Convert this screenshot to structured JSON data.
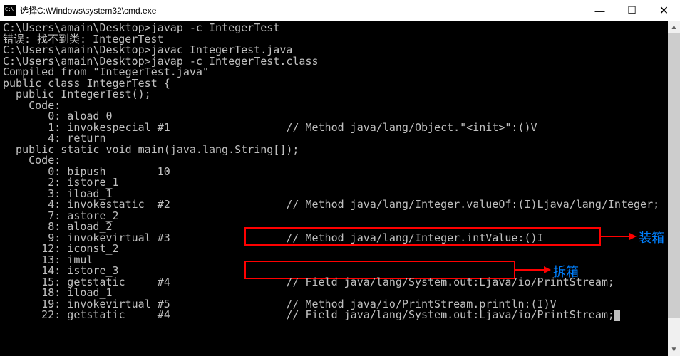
{
  "window": {
    "title": "选择C:\\Windows\\system32\\cmd.exe",
    "buttons": {
      "min": "—",
      "max": "☐",
      "close": "✕"
    }
  },
  "terminal": {
    "line01": "C:\\Users\\amain\\Desktop>javap -c IntegerTest",
    "line02": "错误: 找不到类: IntegerTest",
    "line03": "",
    "line04": "C:\\Users\\amain\\Desktop>javac IntegerTest.java",
    "line05": "",
    "line06": "C:\\Users\\amain\\Desktop>javap -c IntegerTest.class",
    "line07": "Compiled from \"IntegerTest.java\"",
    "line08": "public class IntegerTest {",
    "line09": "  public IntegerTest();",
    "line10": "    Code:",
    "line11": "       0: aload_0",
    "line12": "       1: invokespecial #1                  // Method java/lang/Object.\"<init>\":()V",
    "line13": "       4: return",
    "line14": "",
    "line15": "  public static void main(java.lang.String[]);",
    "line16": "    Code:",
    "line17": "       0: bipush        10",
    "line18": "       2: istore_1",
    "line19": "       3: iload_1",
    "line20": "       4: invokestatic  #2                  // Method java/lang/Integer.valueOf:(I)Ljava/lang/Integer;",
    "line21": "       7: astore_2",
    "line22": "       8: aload_2",
    "line23": "       9: invokevirtual #3                  // Method java/lang/Integer.intValue:()I",
    "line24": "      12: iconst_2",
    "line25": "      13: imul",
    "line26": "      14: istore_3",
    "line27": "      15: getstatic     #4                  // Field java/lang/System.out:Ljava/io/PrintStream;",
    "line28": "      18: iload_1",
    "line29": "      19: invokevirtual #5                  // Method java/io/PrintStream.println:(I)V",
    "line30": "      22: getstatic     #4                  // Field java/lang/System.out:Ljava/io/PrintStream;"
  },
  "annotations": {
    "boxing": "装箱",
    "unboxing": "拆箱"
  }
}
